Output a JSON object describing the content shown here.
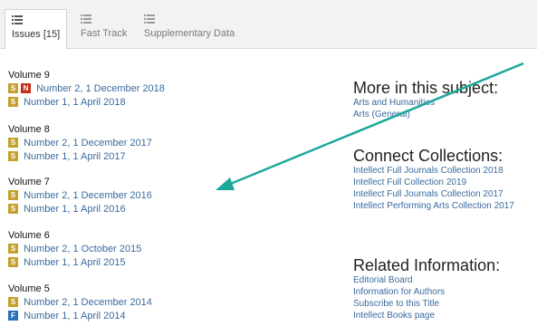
{
  "tabs": [
    {
      "label": "Issues [15]",
      "active": true,
      "icon": "list-icon"
    },
    {
      "label": "Fast Track",
      "active": false,
      "icon": "list-icon"
    },
    {
      "label": "Supplementary Data",
      "active": false,
      "icon": "list-icon"
    }
  ],
  "volumes": [
    {
      "title": "Volume 9",
      "issues": [
        {
          "badges": [
            "S",
            "N"
          ],
          "label": "Number 2, 1 December 2018"
        },
        {
          "badges": [
            "S"
          ],
          "label": "Number 1, 1 April 2018"
        }
      ]
    },
    {
      "title": "Volume 8",
      "issues": [
        {
          "badges": [
            "S"
          ],
          "label": "Number 2, 1 December 2017"
        },
        {
          "badges": [
            "S"
          ],
          "label": "Number 1, 1 April 2017"
        }
      ]
    },
    {
      "title": "Volume 7",
      "issues": [
        {
          "badges": [
            "S"
          ],
          "label": "Number 2, 1 December 2016"
        },
        {
          "badges": [
            "S"
          ],
          "label": "Number 1, 1 April 2016"
        }
      ]
    },
    {
      "title": "Volume 6",
      "issues": [
        {
          "badges": [
            "S"
          ],
          "label": "Number 2, 1 October 2015"
        },
        {
          "badges": [
            "S"
          ],
          "label": "Number 1, 1 April 2015"
        }
      ]
    },
    {
      "title": "Volume 5",
      "issues": [
        {
          "badges": [
            "S"
          ],
          "label": "Number 2, 1 December 2014"
        },
        {
          "badges": [
            "F"
          ],
          "label": "Number 1, 1 April 2014"
        }
      ]
    }
  ],
  "sections": [
    {
      "heading": "More in this subject:",
      "links": [
        "Arts and Humanities",
        "Arts (General)"
      ]
    },
    {
      "heading": "Connect Collections:",
      "links": [
        "Intellect Full Journals Collection 2018",
        "Intellect Full Collection 2019",
        "Intellect Full Journals Collection 2017",
        "Intellect Performing Arts Collection 2017"
      ]
    },
    {
      "heading": "Related Information:",
      "links": [
        "Editorial Board",
        "Information for Authors",
        "Subscribe to this Title",
        "Intellect Books page"
      ]
    }
  ],
  "colors": {
    "badge_S": "#c4a12c",
    "badge_N": "#c22d1c",
    "badge_F": "#2c6fb8",
    "link": "#3a6a9e",
    "arrow": "#1aa89a"
  }
}
